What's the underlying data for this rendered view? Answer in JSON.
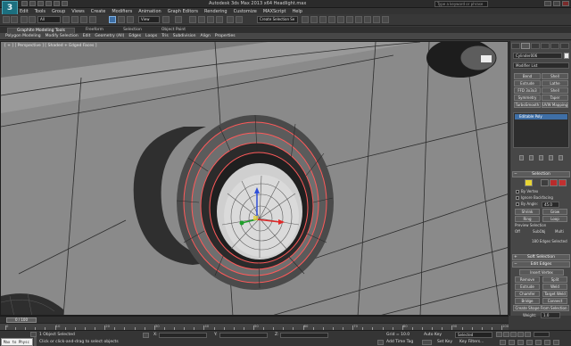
{
  "app": {
    "logo": "3",
    "title": "Autodesk 3ds Max 2013 x64    Headlight.max",
    "search_placeholder": "Type a keyword or phrase"
  },
  "menu": [
    "Edit",
    "Tools",
    "Group",
    "Views",
    "Create",
    "Modifiers",
    "Animation",
    "Graph Editors",
    "Rendering",
    "Customize",
    "MAXScript",
    "Help"
  ],
  "toolbar": {
    "selection_filter": "All",
    "reference_coord": "View",
    "named_selection": "Create Selection Se"
  },
  "ribbon": {
    "tabs": [
      "Graphite Modeling Tools",
      "Freeform",
      "Selection",
      "Object Paint"
    ],
    "active_tab": "Graphite Modeling Tools",
    "panel_items": [
      "Polygon Modeling",
      "Modify Selection",
      "Edit",
      "Geometry (All)",
      "Edges",
      "Loops",
      "Tris",
      "Subdivision",
      "Align",
      "Properties"
    ]
  },
  "viewport": {
    "label": "[ + ] [ Perspective ] [ Shaded + Edged Faces ]"
  },
  "command_panel": {
    "object_name": "Cylinder006",
    "object_color": "#ececec",
    "modifier_list": "Modifier List",
    "modifier_buttons": [
      "Bend",
      "Shell",
      "Extrude",
      "Lathe",
      "FFD 3x3x3",
      "Shell",
      "Symmetry",
      "Taper",
      "TurboSmooth",
      "UVW Mapping Cle"
    ],
    "stack_item": "Editable Poly",
    "selection_rollout": "Selection",
    "by_vertex": "By Vertex",
    "ignore_backfacing": "Ignore Backfacing",
    "by_angle": "By Angle:",
    "by_angle_value": "45.0",
    "shrink": "Shrink",
    "grow": "Grow",
    "ring": "Ring",
    "loop": "Loop",
    "preview_selection": "Preview Selection",
    "preview_options": [
      "Off",
      "SubObj",
      "Multi"
    ],
    "selection_count": "180 Edges Selected",
    "soft_selection_rollout": "Soft Selection",
    "edit_edges_rollout": "Edit Edges",
    "insert_vertex": "Insert Vertex",
    "remove": "Remove",
    "split": "Split",
    "extrude": "Extrude",
    "weld": "Weld",
    "chamfer": "Chamfer",
    "target_weld": "Target Weld",
    "bridge": "Bridge",
    "connect": "Connect",
    "create_shape": "Create Shape From Selection",
    "weight_label": "Weight:",
    "weight_value": "1.0",
    "crease_label": "Crease:",
    "crease_value": "0.0"
  },
  "timeline": {
    "slider_label": "0 / 100",
    "ticks": [
      "0",
      "10",
      "20",
      "30",
      "40",
      "50",
      "60",
      "70",
      "80",
      "90",
      "100"
    ]
  },
  "status": {
    "maxscript_text": "Max to Physc",
    "selection_info": "1 Object Selected",
    "prompt": "Click or click-and-drag to select objects",
    "grid": "Grid = 10.0",
    "autokey": "Auto Key",
    "set_key": "Set Key",
    "key_mode_dropdown": "Selected",
    "key_filters": "Key Filters...",
    "add_time_tag": "Add Time Tag",
    "x_label": "X:",
    "y_label": "Y:",
    "z_label": "Z:"
  },
  "colors": {
    "selected_edge": "#ff5a5a",
    "viewport_bg": "#7b7b7b",
    "highlight": "#3e6fa5"
  }
}
